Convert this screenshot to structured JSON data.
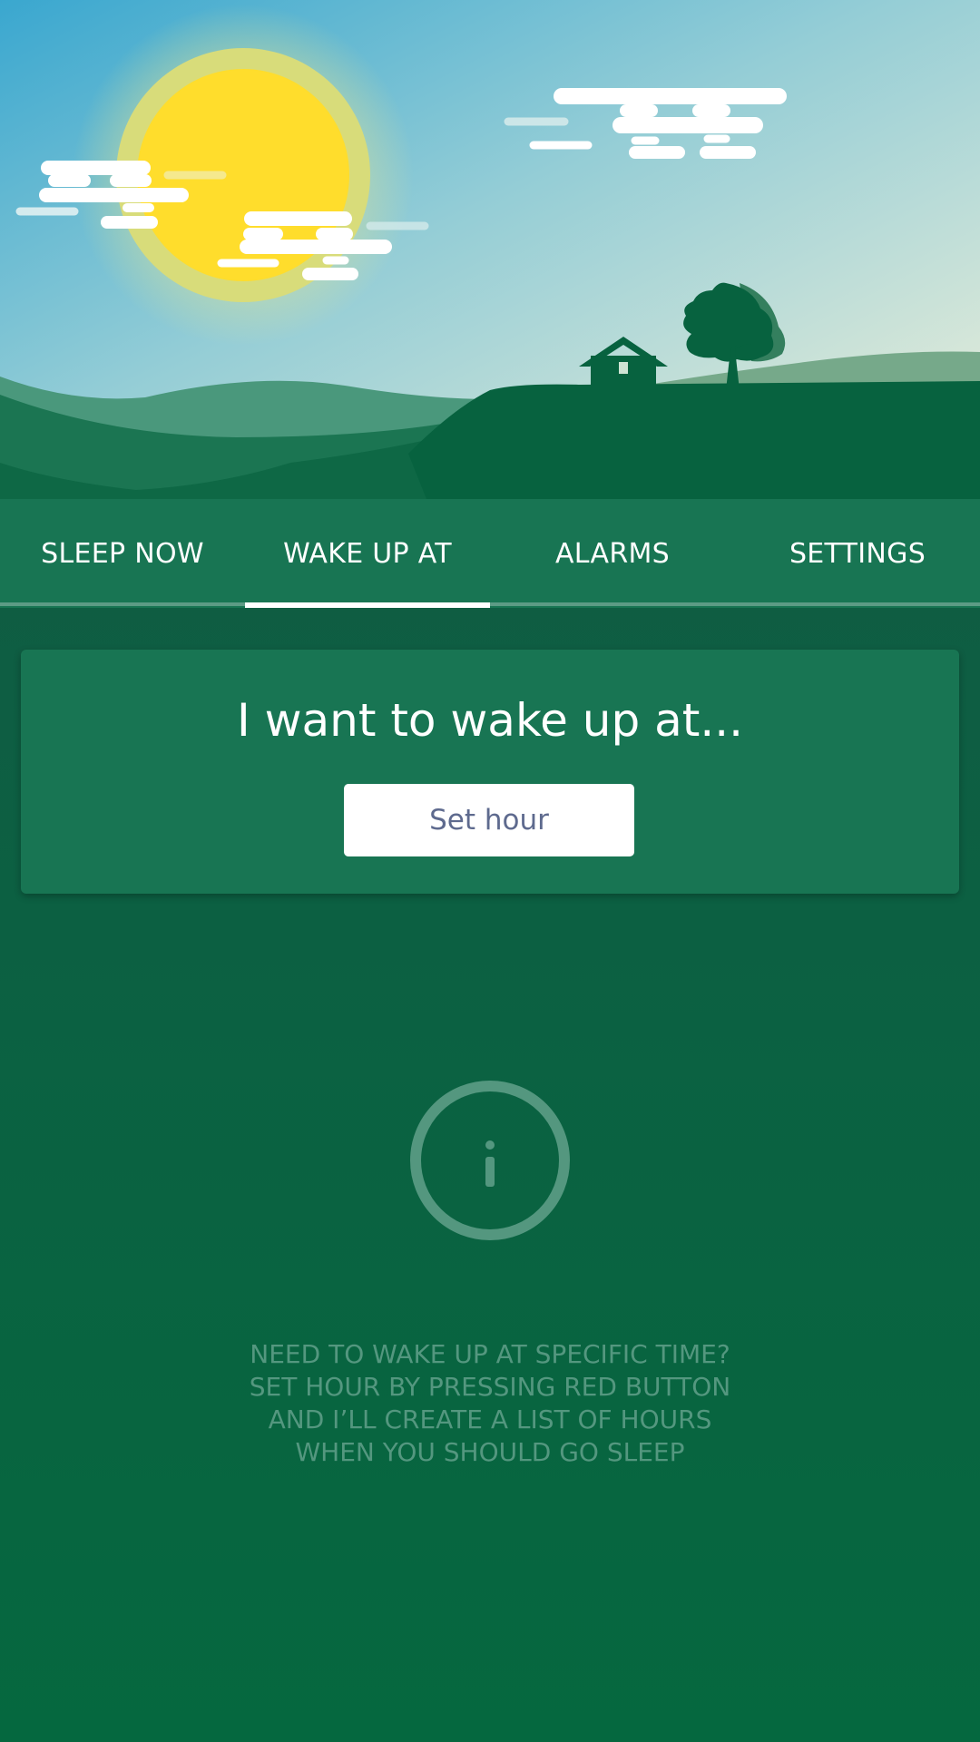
{
  "tabs": [
    {
      "label": "SLEEP NOW"
    },
    {
      "label": "WAKE UP AT"
    },
    {
      "label": "ALARMS"
    },
    {
      "label": "SETTINGS"
    }
  ],
  "active_tab": "WAKE UP AT",
  "card": {
    "title": "I want to wake up at...",
    "button_label": "Set hour"
  },
  "info": {
    "icon": "info-icon",
    "lines": [
      "NEED TO WAKE UP AT SPECIFIC TIME?",
      "SET HOUR BY PRESSING RED BUTTON",
      "AND I’LL CREATE A LIST OF HOURS",
      "WHEN YOU SHOULD GO SLEEP"
    ]
  },
  "colors": {
    "tab_bar": "#187553",
    "card": "#187553",
    "background_top": "#15573f",
    "background_bottom": "#05683f",
    "info_text": "#54977f",
    "button_text": "#5e6a8e"
  }
}
